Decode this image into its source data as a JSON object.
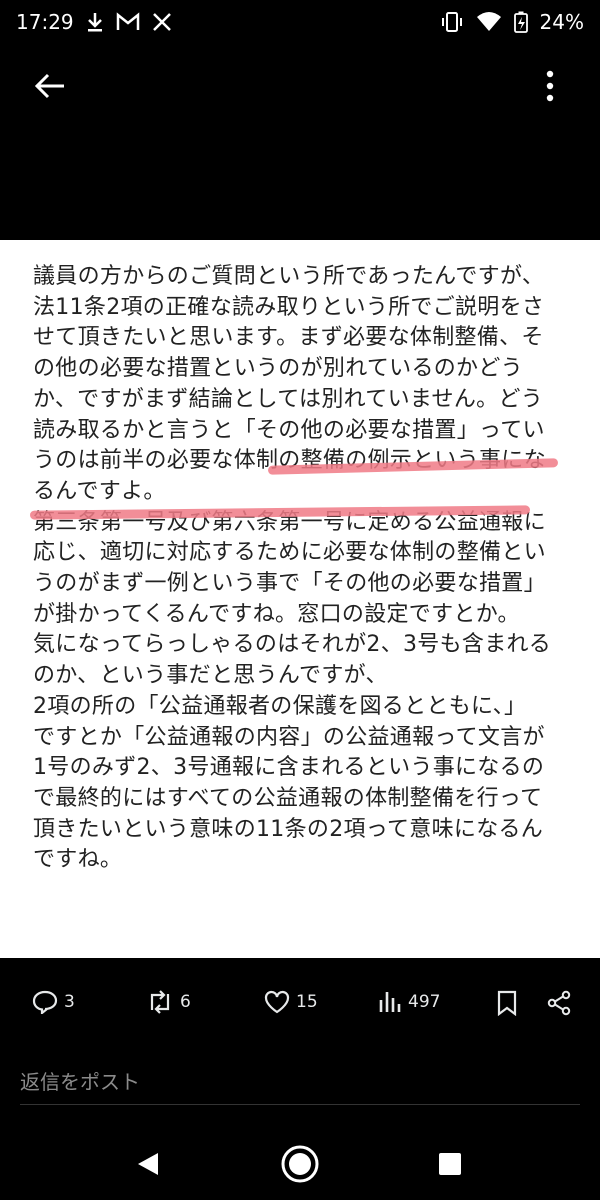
{
  "status_bar": {
    "time": "17:29",
    "battery": "24%",
    "icons": [
      "download-icon",
      "gmail-icon",
      "x-icon",
      "vibrate-icon",
      "wifi-icon",
      "battery-icon"
    ]
  },
  "top_bar": {
    "icons": [
      "back-arrow-icon",
      "more-vertical-icon"
    ]
  },
  "document": {
    "lines": [
      "議員の方からのご質問という所であったんですが、",
      "法11条2項の正確な読み取りという所でご説明をさ",
      "せて頂きたいと思います。まず必要な体制整備、そ",
      "の他の必要な措置というのが別れているのかどう",
      "か、ですがまず結論としては別れていません。どう",
      "読み取るかと言うと「その他の必要な措置」ってい",
      "うのは前半の必要な体制の整備の例示という事にな",
      "るんですよ。",
      "第三条第一号及び第六条第一号に定める公益通報に",
      "応じ、適切に対応するために必要な体制の整備とい",
      "うのがまず一例という事で「その他の必要な措置」",
      "が掛かってくるんですね。窓口の設定ですとか。",
      "気になってらっしゃるのはそれが2、3号も含まれる",
      "のか、という事だと思うんですが、",
      "2項の所の「公益通報者の保護を図るとともに、」",
      "ですとか「公益通報の内容」の公益通報って文言が",
      "1号のみず2、3号通報に含まれるという事になるの",
      "で最終的にはすべての公益通報の体制整備を行って",
      "頂きたいという意味の11条の2項って意味になるん",
      "ですね。"
    ]
  },
  "actions": {
    "reply_count": "3",
    "repost_count": "6",
    "like_count": "15",
    "view_count": "497"
  },
  "reply": {
    "placeholder": "返信をポスト"
  },
  "colors": {
    "highlight": "#f07a86",
    "background": "#000000",
    "panel": "#ffffff"
  }
}
